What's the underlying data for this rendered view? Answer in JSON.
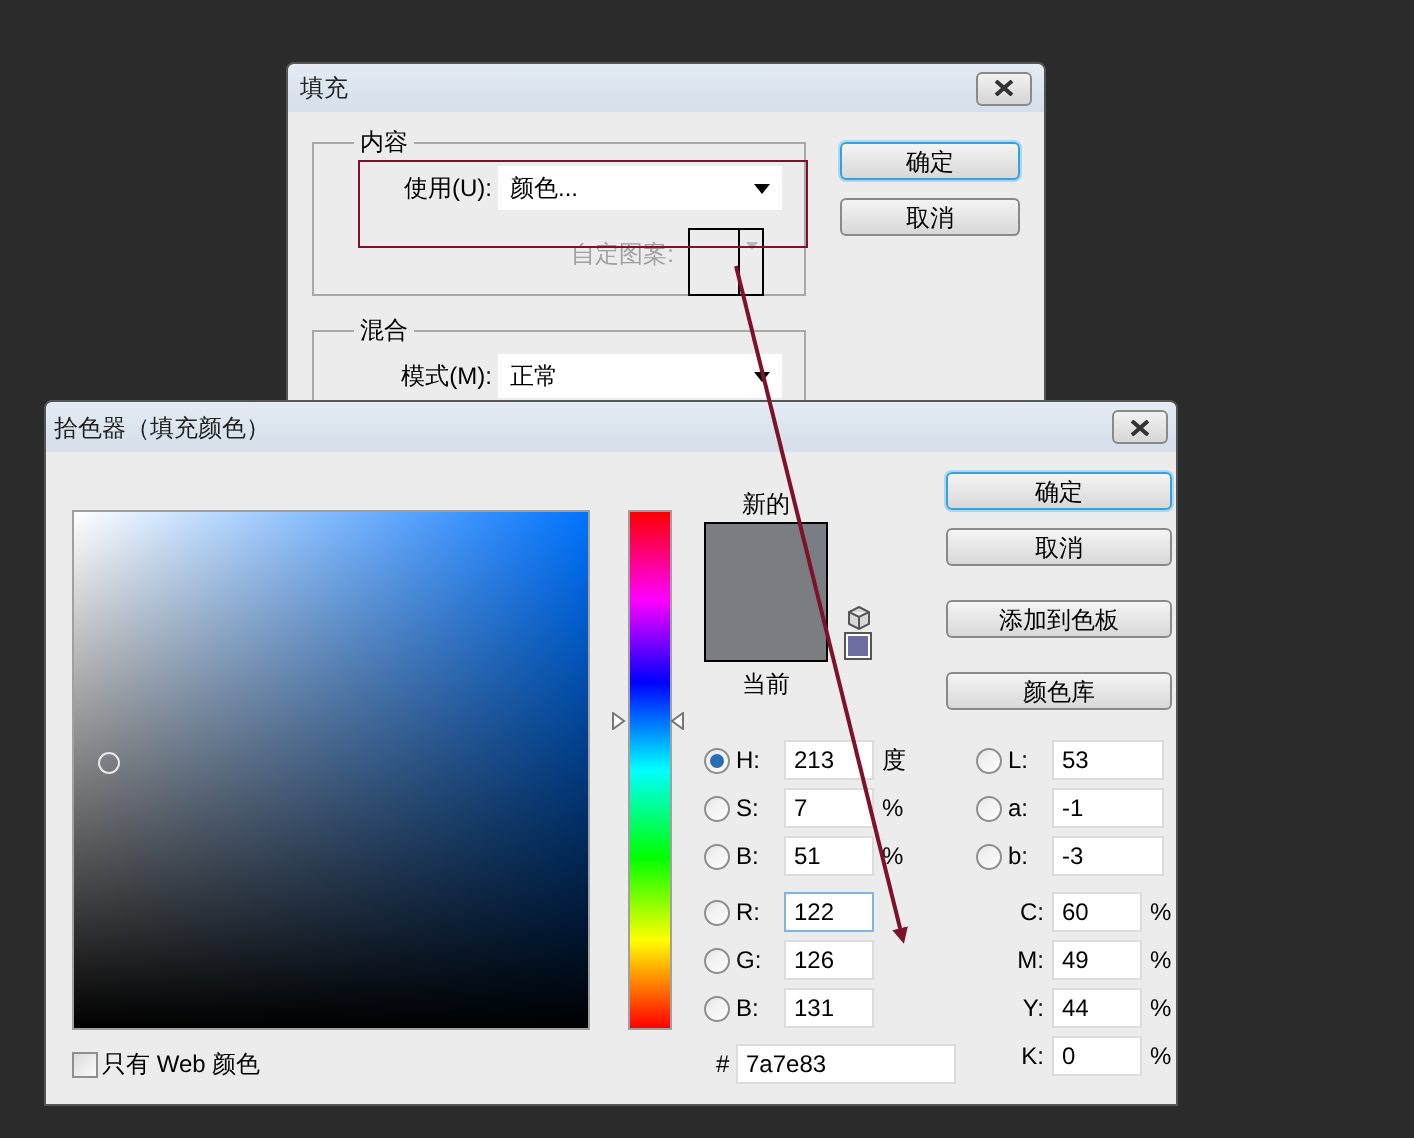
{
  "fill_dialog": {
    "title": "填充",
    "content": {
      "title": "内容",
      "use_label": "使用(U):",
      "use_value": "颜色...",
      "pattern_label": "自定图案:",
      "pattern_disabled": true
    },
    "blend": {
      "title": "混合",
      "mode_label": "模式(M):",
      "mode_value": "正常"
    },
    "buttons": [
      {
        "label": "确定",
        "default": true
      },
      {
        "label": "取消",
        "default": false
      }
    ]
  },
  "picker": {
    "title": "拾色器（填充颜色）",
    "new_label": "新的",
    "current_label": "当前",
    "hue_slider": {
      "level": 0.592
    },
    "buttons": [
      {
        "label": "确定",
        "default": true
      },
      {
        "label": "取消",
        "default": false
      },
      {
        "label": "添加到色板",
        "default": false
      },
      {
        "label": "颜色库",
        "default": false
      }
    ],
    "hsb": [
      {
        "kind": "radio",
        "label": "H:",
        "value": "213",
        "unit": "度",
        "selected": true,
        "focused": false
      },
      {
        "kind": "radio",
        "label": "S:",
        "value": "7",
        "unit": "%",
        "selected": false,
        "focused": false
      },
      {
        "kind": "radio",
        "label": "B:",
        "value": "51",
        "unit": "%",
        "selected": false,
        "focused": false
      }
    ],
    "rgb": [
      {
        "kind": "radio",
        "label": "R:",
        "value": "122",
        "selected": false,
        "focused": true
      },
      {
        "kind": "radio",
        "label": "G:",
        "value": "126",
        "selected": false,
        "focused": false
      },
      {
        "kind": "radio",
        "label": "B:",
        "value": "131",
        "selected": false,
        "focused": false
      }
    ],
    "lab": [
      {
        "kind": "radio",
        "label": "L:",
        "value": "53",
        "selected": false,
        "focused": false
      },
      {
        "kind": "radio",
        "label": "a:",
        "value": "-1",
        "selected": false,
        "focused": false
      },
      {
        "kind": "radio",
        "label": "b:",
        "value": "-3",
        "selected": false,
        "focused": false
      }
    ],
    "cmyk": [
      {
        "kind": "plain",
        "label": "C:",
        "value": "60",
        "unit": "%",
        "focused": false
      },
      {
        "kind": "plain",
        "label": "M:",
        "value": "49",
        "unit": "%",
        "focused": false
      },
      {
        "kind": "plain",
        "label": "Y:",
        "value": "44",
        "unit": "%",
        "focused": false
      },
      {
        "kind": "plain",
        "label": "K:",
        "value": "0",
        "unit": "%",
        "focused": false
      }
    ],
    "hex": {
      "label": "#",
      "value": "7a7e83"
    },
    "web_only": {
      "label": "只有 Web 颜色",
      "checked": false
    }
  }
}
